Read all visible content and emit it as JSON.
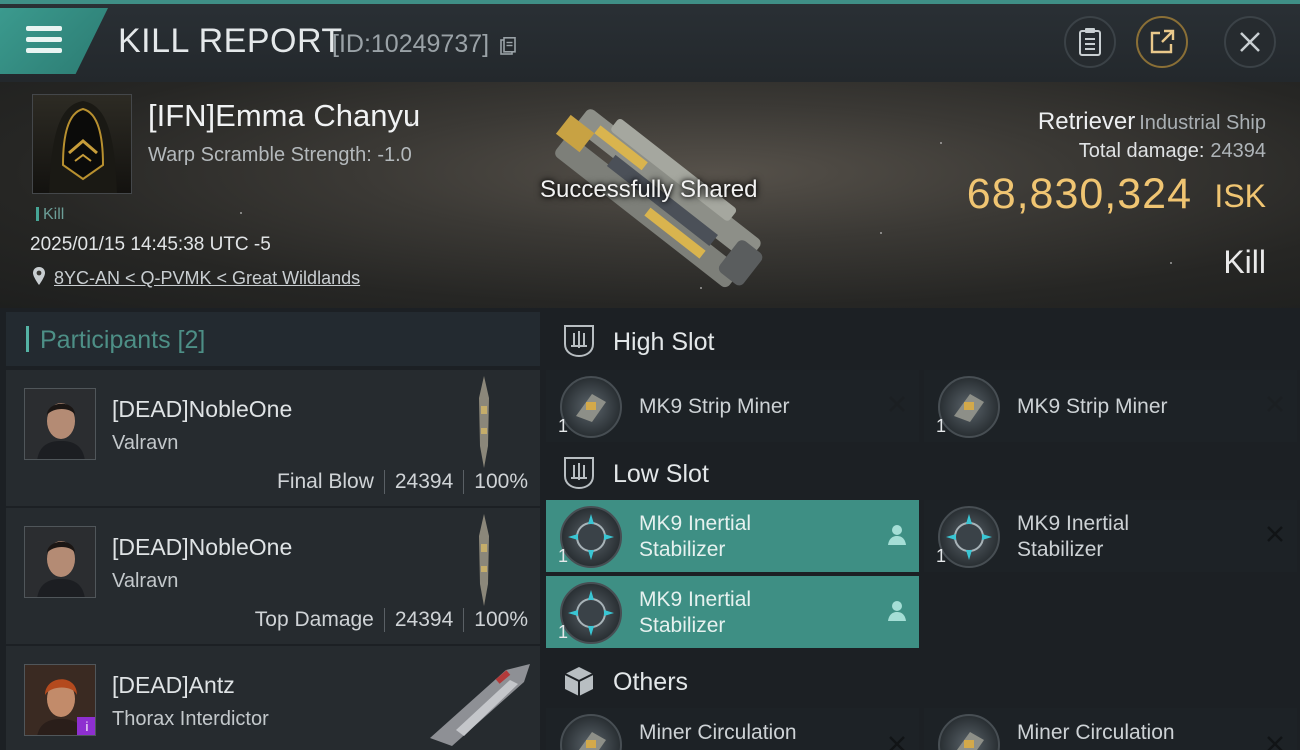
{
  "header": {
    "title": "KILL REPORT",
    "report_id": "[ID:10249737]"
  },
  "victim": {
    "name": "[IFN]Emma Chanyu",
    "warp_scramble": "Warp Scramble Strength: -1.0",
    "tag": "Kill",
    "timestamp": "2025/01/15 14:45:38 UTC -5",
    "location": "8YC-AN < Q-PVMK < Great Wildlands",
    "ship": "Retriever",
    "ship_class": "Industrial Ship",
    "total_damage_label": "Total damage:",
    "total_damage": "24394",
    "isk_value": "68,830,324",
    "isk_unit": "ISK",
    "result": "Kill"
  },
  "toast": "Successfully Shared",
  "participants": {
    "label": "Participants [2]",
    "items": [
      {
        "name": "[DEAD]NobleOne",
        "ship": "Valravn",
        "role": "Final Blow",
        "damage": "24394",
        "percent": "100%"
      },
      {
        "name": "[DEAD]NobleOne",
        "ship": "Valravn",
        "role": "Top Damage",
        "damage": "24394",
        "percent": "100%"
      },
      {
        "name": "[DEAD]Antz",
        "ship": "Thorax Interdictor",
        "badge": "i"
      }
    ]
  },
  "fitting": {
    "high_slot": {
      "label": "High Slot",
      "modules": [
        {
          "name": "MK9 Strip Miner",
          "qty": "1"
        },
        {
          "name": "MK9 Strip Miner",
          "qty": "1"
        }
      ]
    },
    "low_slot": {
      "label": "Low Slot",
      "modules": [
        {
          "line1": "MK9 Inertial",
          "line2": "Stabilizer",
          "qty": "1"
        },
        {
          "line1": "MK9 Inertial",
          "line2": "Stabilizer",
          "qty": "1"
        },
        {
          "line1": "MK9 Inertial",
          "line2": "Stabilizer",
          "qty": "1"
        }
      ]
    },
    "others": {
      "label": "Others",
      "modules": [
        {
          "name": "Miner Circulation"
        },
        {
          "name": "Miner Circulation"
        }
      ]
    }
  },
  "colors": {
    "accent": "#3e8f84",
    "isk": "#f0c572",
    "background": "#1c2024"
  },
  "icons": [
    "menu-icon",
    "copy-icon",
    "clipboard-icon",
    "share-icon",
    "close-icon",
    "location-pin-icon",
    "high-slot-icon",
    "low-slot-icon",
    "others-box-icon",
    "remove-x-icon",
    "person-icon"
  ]
}
